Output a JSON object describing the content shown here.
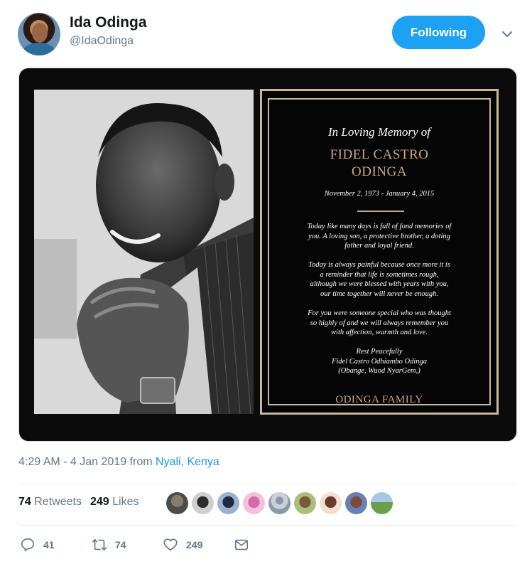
{
  "user": {
    "name": "Ida Odinga",
    "handle": "@IdaOdinga",
    "follow_label": "Following"
  },
  "card": {
    "heading": "In Loving Memory of",
    "name_line1": "FIDEL CASTRO",
    "name_line2": "ODINGA",
    "dates": "November 2, 1973 - January 4, 2015",
    "paragraph1": "Today like many days is full of fond memories of\nyou. A loving son, a protective brother, a doting\nfather and loyal friend.",
    "paragraph2": "Today is always painful because once more it is\na reminder that life is sometimes rough,\nalthough we were blessed with years with you,\nour time together will never be enough.",
    "paragraph3": "For you were someone special who was thought\nso highly of and we will always remember you\nwith affection, warmth and love.",
    "signoff": "Rest Peacefully\nFidel Castro Odhiambo Odinga\n(Obange, Wuod NyarGem,)",
    "family": "ODINGA FAMILY"
  },
  "meta": {
    "time": "4:29 AM - 4 Jan 2019 from ",
    "location": "Nyali, Kenya"
  },
  "stats": {
    "retweets_count": "74",
    "retweets_label": "Retweets",
    "likes_count": "249",
    "likes_label": "Likes"
  },
  "actions": {
    "replies": "41",
    "retweets": "74",
    "likes": "249"
  },
  "colors": {
    "accent": "#1da1f2",
    "gold": "#c5aa84"
  }
}
